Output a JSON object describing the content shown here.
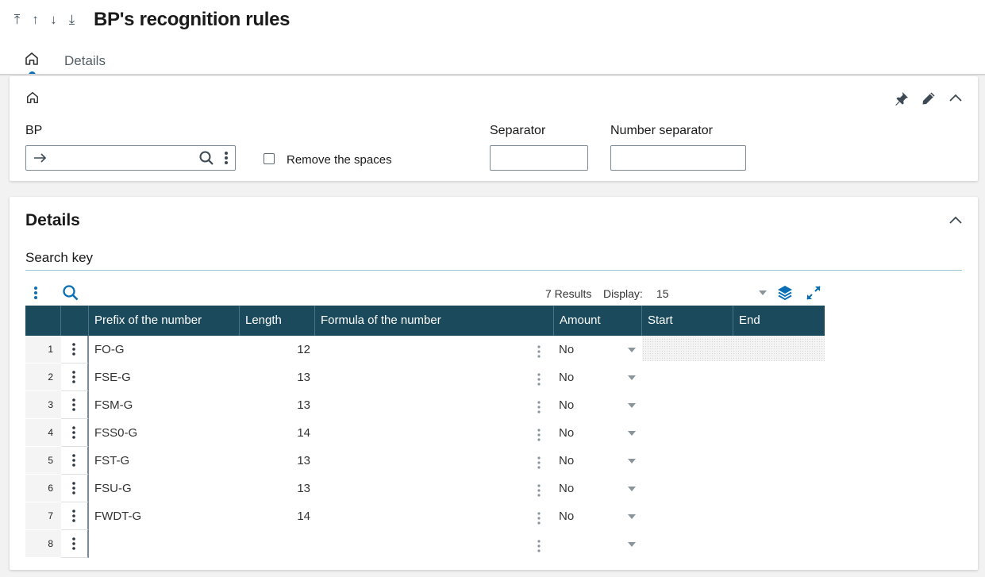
{
  "header": {
    "title": "BP's recognition rules",
    "nav_arrows": [
      "first-icon",
      "up-icon",
      "down-icon",
      "last-icon"
    ],
    "tabs": [
      {
        "icon": "home-icon",
        "active": true
      },
      {
        "label": "Details"
      }
    ]
  },
  "panel_main": {
    "bp_label": "BP",
    "bp_value": "",
    "remove_spaces_label": "Remove the spaces",
    "remove_spaces_checked": false,
    "separator_label": "Separator",
    "separator_value": "",
    "number_separator_label": "Number separator",
    "number_separator_value": ""
  },
  "details": {
    "title": "Details",
    "section_title": "Search key",
    "results_text": "7 Results",
    "display_label": "Display:",
    "display_value": "15",
    "columns": [
      "Prefix of the number",
      "Length",
      "Formula of the number",
      "Amount",
      "Start",
      "End"
    ],
    "rows": [
      {
        "num": "1",
        "prefix": "FO-G",
        "length": "12",
        "formula": "",
        "amount": "No",
        "start": "",
        "end": ""
      },
      {
        "num": "2",
        "prefix": "FSE-G",
        "length": "13",
        "formula": "",
        "amount": "No",
        "start": "",
        "end": ""
      },
      {
        "num": "3",
        "prefix": "FSM-G",
        "length": "13",
        "formula": "",
        "amount": "No",
        "start": "",
        "end": ""
      },
      {
        "num": "4",
        "prefix": "FSS0-G",
        "length": "14",
        "formula": "",
        "amount": "No",
        "start": "",
        "end": ""
      },
      {
        "num": "5",
        "prefix": "FST-G",
        "length": "13",
        "formula": "",
        "amount": "No",
        "start": "",
        "end": ""
      },
      {
        "num": "6",
        "prefix": "FSU-G",
        "length": "13",
        "formula": "",
        "amount": "No",
        "start": "",
        "end": ""
      },
      {
        "num": "7",
        "prefix": "FWDT-G",
        "length": "14",
        "formula": "",
        "amount": "No",
        "start": "",
        "end": ""
      },
      {
        "num": "8",
        "prefix": "",
        "length": "",
        "formula": "",
        "amount": "",
        "start": "",
        "end": ""
      }
    ]
  },
  "colors": {
    "grid_header": "#1a4a5c",
    "accent": "#0b6fb5",
    "panel_bg": "#ffffff",
    "page_bg": "#f2f2f2"
  }
}
